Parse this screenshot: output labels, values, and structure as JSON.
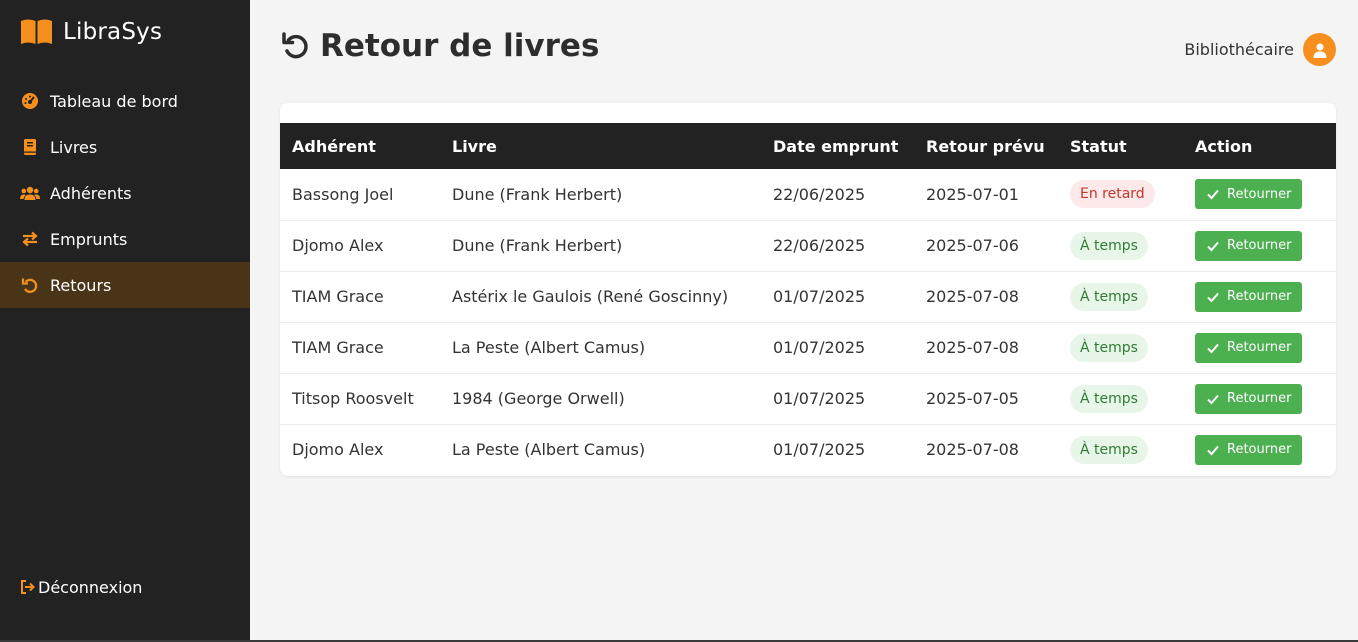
{
  "app": {
    "name": "LibraSys",
    "accent_color": "#f5901e",
    "sidebar_bg": "#222222",
    "active_bg": "#4a3418"
  },
  "sidebar": {
    "items": [
      {
        "label": "Tableau de bord",
        "icon": "dashboard-icon",
        "active": false
      },
      {
        "label": "Livres",
        "icon": "book-icon",
        "active": false
      },
      {
        "label": "Adhérents",
        "icon": "users-icon",
        "active": false
      },
      {
        "label": "Emprunts",
        "icon": "exchange-icon",
        "active": false
      },
      {
        "label": "Retours",
        "icon": "undo-icon",
        "active": true
      }
    ],
    "logout_label": "Déconnexion"
  },
  "header": {
    "title": "Retour de livres",
    "user_label": "Bibliothécaire"
  },
  "table": {
    "columns": [
      "Adhérent",
      "Livre",
      "Date emprunt",
      "Retour prévu",
      "Statut",
      "Action"
    ],
    "rows": [
      {
        "member": "Bassong Joel",
        "book": "Dune (Frank Herbert)",
        "loan_date": "22/06/2025",
        "due_date": "2025-07-01",
        "status": "En retard",
        "status_type": "late",
        "action": "Retourner"
      },
      {
        "member": "Djomo Alex",
        "book": "Dune (Frank Herbert)",
        "loan_date": "22/06/2025",
        "due_date": "2025-07-06",
        "status": "À temps",
        "status_type": "ok",
        "action": "Retourner"
      },
      {
        "member": "TIAM Grace",
        "book": "Astérix le Gaulois (René Goscinny)",
        "loan_date": "01/07/2025",
        "due_date": "2025-07-08",
        "status": "À temps",
        "status_type": "ok",
        "action": "Retourner"
      },
      {
        "member": "TIAM Grace",
        "book": "La Peste (Albert Camus)",
        "loan_date": "01/07/2025",
        "due_date": "2025-07-08",
        "status": "À temps",
        "status_type": "ok",
        "action": "Retourner"
      },
      {
        "member": "Titsop Roosvelt",
        "book": "1984 (George Orwell)",
        "loan_date": "01/07/2025",
        "due_date": "2025-07-05",
        "status": "À temps",
        "status_type": "ok",
        "action": "Retourner"
      },
      {
        "member": "Djomo Alex",
        "book": "La Peste (Albert Camus)",
        "loan_date": "01/07/2025",
        "due_date": "2025-07-08",
        "status": "À temps",
        "status_type": "ok",
        "action": "Retourner"
      }
    ]
  }
}
